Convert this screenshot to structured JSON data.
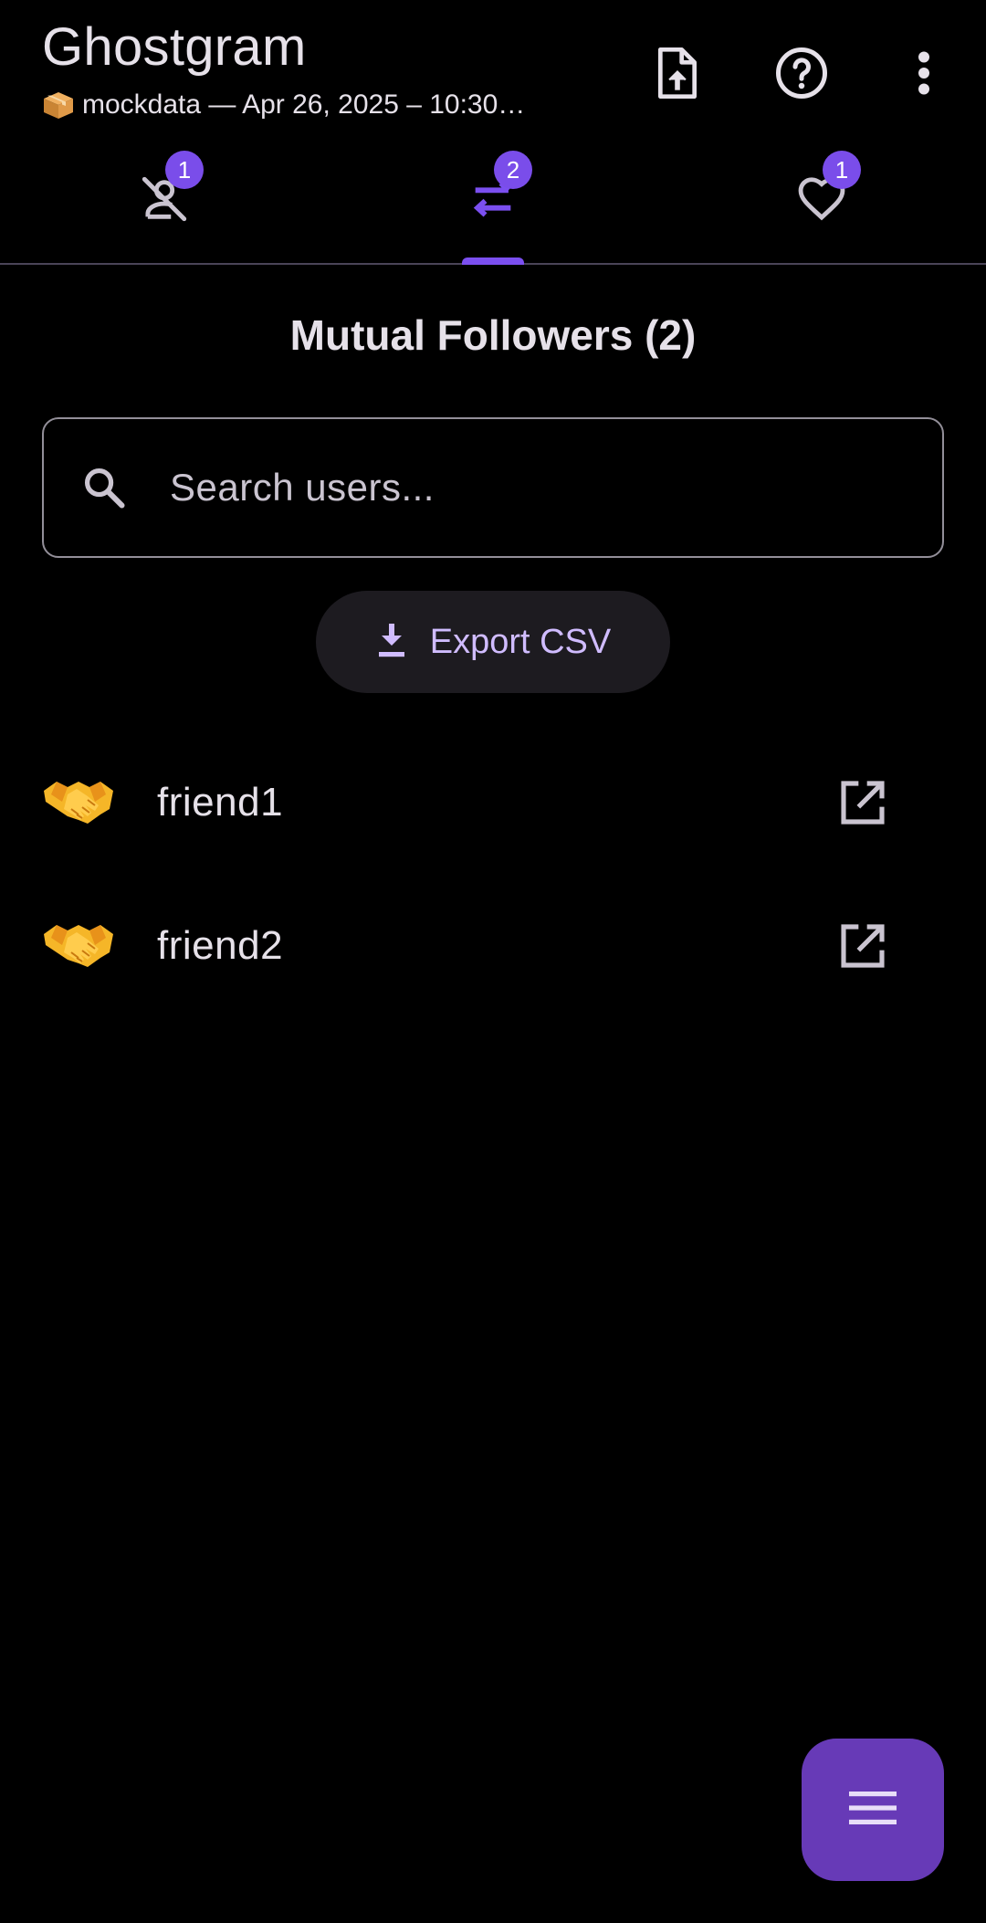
{
  "app": {
    "title": "Ghostgram",
    "subtitle": "mockdata — Apr 26, 2025 – 10:30…",
    "subtitle_icon": "package-icon"
  },
  "actions": [
    {
      "name": "upload-file-button",
      "icon": "file-upload-icon"
    },
    {
      "name": "help-button",
      "icon": "help-circle-icon"
    },
    {
      "name": "more-options-button",
      "icon": "more-vert-icon"
    }
  ],
  "tabs": [
    {
      "icon": "person-off-icon",
      "badge": "1",
      "selected": false
    },
    {
      "icon": "swap-arrows-icon",
      "badge": "2",
      "selected": true
    },
    {
      "icon": "heart-outline-icon",
      "badge": "1",
      "selected": false
    }
  ],
  "section": {
    "title": "Mutual Followers (2)"
  },
  "search": {
    "placeholder": "Search users...",
    "value": ""
  },
  "export": {
    "label": "Export CSV",
    "icon": "download-icon"
  },
  "users": [
    {
      "name": "friend1",
      "icon": "handshake-icon"
    },
    {
      "name": "friend2",
      "icon": "handshake-icon"
    }
  ],
  "fab": {
    "icon": "menu-icon"
  },
  "colors": {
    "background": "#000000",
    "accent": "#7a4dea",
    "fab": "#673ab7",
    "button_text": "#d0bcff",
    "text": "#e6e1e9"
  }
}
